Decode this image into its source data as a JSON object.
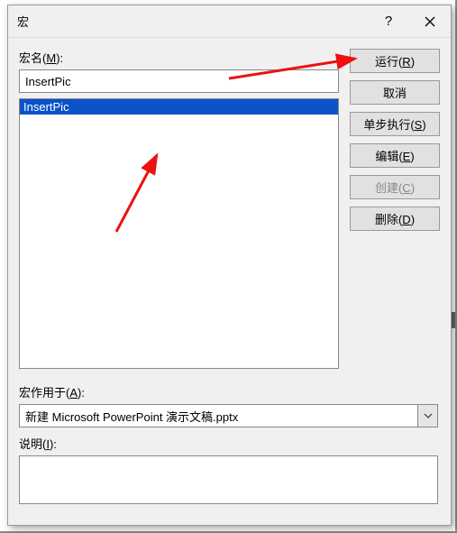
{
  "title": "宏",
  "help_glyph": "?",
  "labels": {
    "macro_name": "宏名(M):",
    "macro_in": "宏作用于(A):",
    "description": "说明(I):"
  },
  "fields": {
    "macro_name_value": "InsertPic",
    "macro_in_value": "新建 Microsoft PowerPoint 演示文稿.pptx",
    "description_value": ""
  },
  "macro_list": [
    "InsertPic"
  ],
  "buttons": {
    "run": "运行(R)",
    "cancel": "取消",
    "step": "单步执行(S)",
    "edit": "编辑(E)",
    "create": "创建(C)",
    "delete": "删除(D)"
  }
}
